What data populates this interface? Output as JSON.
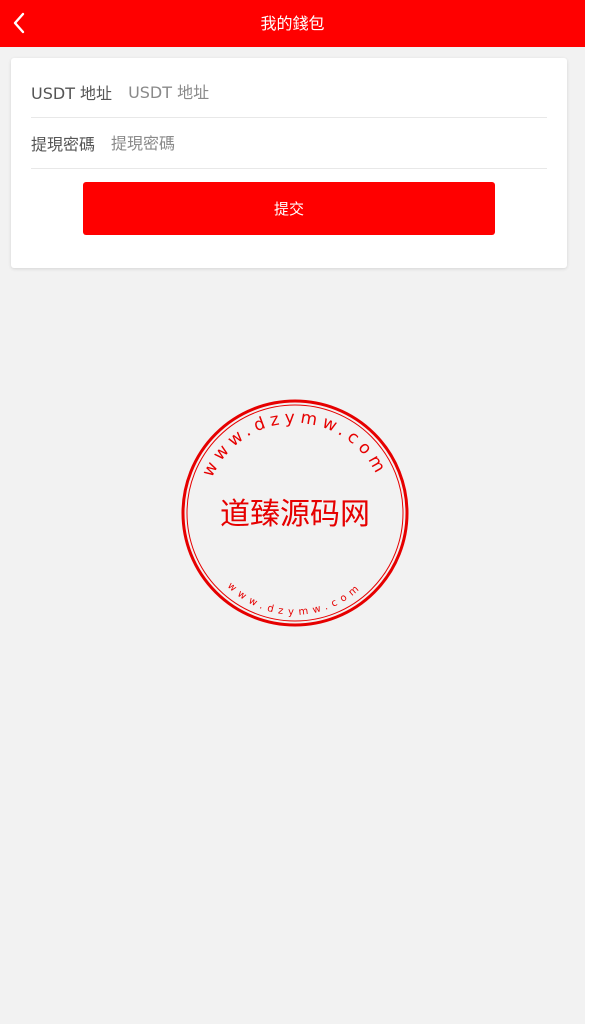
{
  "header": {
    "title": "我的錢包",
    "back_icon": "chevron-left-icon",
    "background_color": "#ff0000"
  },
  "form": {
    "address_label": "USDT 地址",
    "address_placeholder": "USDT 地址",
    "password_label": "提現密碼",
    "password_placeholder": "提現密碼",
    "submit_label": "提交"
  },
  "watermark": {
    "name": "道臻源码网",
    "top_url": "www.dzymw.com",
    "bottom_url": "www.dzymw.com",
    "color": "#e60000"
  }
}
